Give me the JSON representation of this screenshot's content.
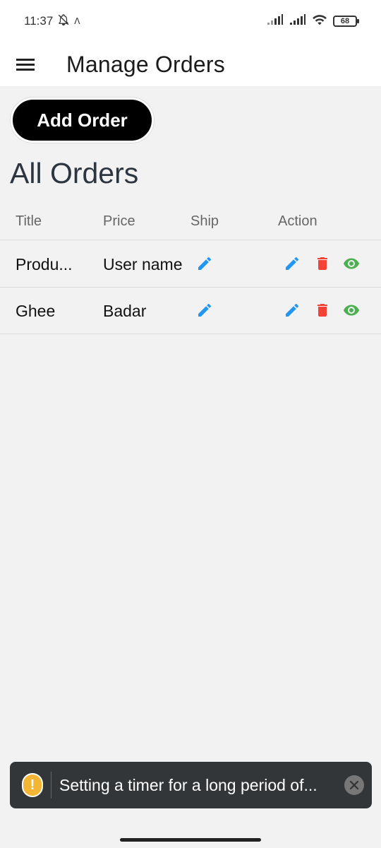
{
  "status_bar": {
    "time": "11:37",
    "battery": "68",
    "icons": [
      "bell-off-icon",
      "signal-icon",
      "wifi-icon",
      "battery-icon"
    ]
  },
  "app_bar": {
    "title": "Manage Orders",
    "menu_icon": "menu-icon"
  },
  "add_button": {
    "label": "Add Order"
  },
  "section_title": "All Orders",
  "table": {
    "columns": [
      "Title",
      "Price",
      "Ship",
      "Action"
    ],
    "rows": [
      {
        "title": "Produ...",
        "price": "User name"
      },
      {
        "title": "Ghee",
        "price": "Badar"
      }
    ],
    "icons": {
      "ship": "edit-icon",
      "actions": [
        "edit-icon",
        "delete-icon",
        "view-icon"
      ]
    }
  },
  "toast": {
    "message": "Setting a timer for a long period of...",
    "icon": "warning-icon",
    "warn_glyph": "!",
    "close_icon": "close-icon"
  },
  "colors": {
    "edit": "#2196f3",
    "delete": "#f44336",
    "view": "#4caf50",
    "background": "#f2f2f2"
  }
}
